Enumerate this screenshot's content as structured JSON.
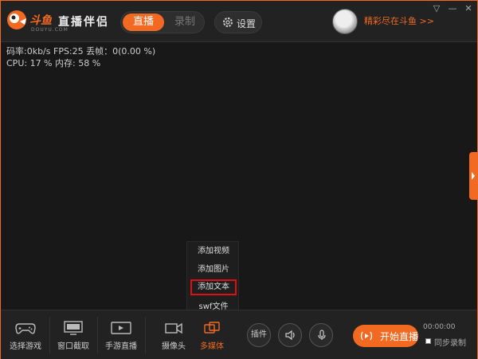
{
  "header": {
    "logo_text": "斗鱼",
    "logo_sub": "DOUYU.COM",
    "app_title": "直播伴侣",
    "mode_live": "直播",
    "mode_record": "录制",
    "settings_label": "设置",
    "promo": "精彩尽在斗鱼 >>",
    "win_controls": {
      "menu": "▽",
      "minimize": "—",
      "close": "✕"
    }
  },
  "stats": {
    "line1": "码率:0kb/s   FPS:25   丢帧：0(0.00 %)",
    "line2": "CPU: 17 %    内存: 58 %"
  },
  "popup_menu": {
    "items": [
      "添加视频",
      "添加图片",
      "添加文本",
      "swf文件"
    ]
  },
  "toolbar": {
    "buttons": [
      {
        "label": "选择游戏",
        "icon": "gamepad-icon"
      },
      {
        "label": "窗口截取",
        "icon": "monitor-icon"
      },
      {
        "label": "手游直播",
        "icon": "phone-landscape-icon"
      },
      {
        "label": "摄像头",
        "icon": "camera-icon"
      },
      {
        "label": "多媒体",
        "icon": "multimedia-icon"
      }
    ],
    "plugins_label": "插件",
    "start_label": "开始直播",
    "timer": "00:00:00",
    "sync_record": "同步录制"
  },
  "colors": {
    "accent": "#f26a21",
    "background": "#181818",
    "toolbar": "#222222",
    "highlight_border": "#dd1111"
  }
}
